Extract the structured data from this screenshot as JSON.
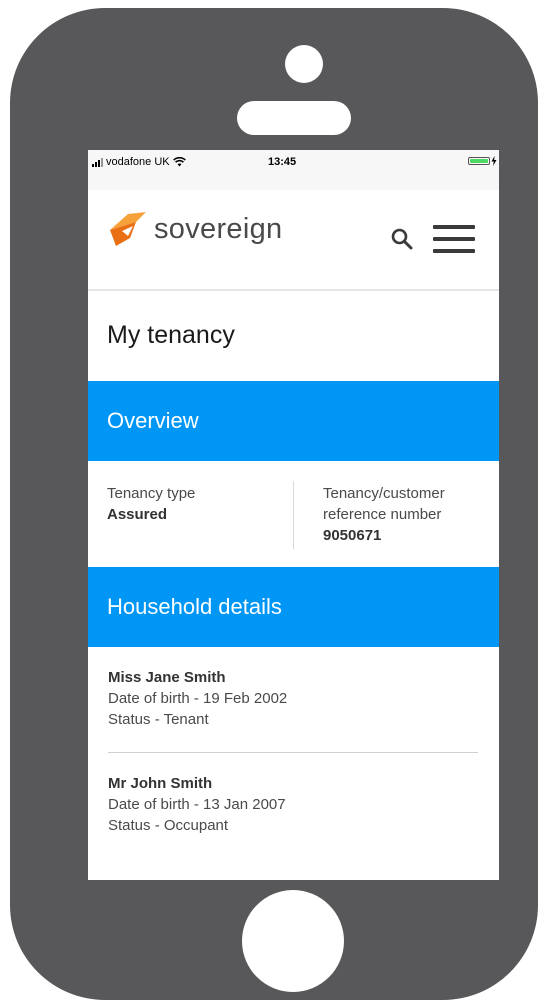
{
  "status_bar": {
    "carrier": "vodafone UK",
    "time": "13:45"
  },
  "header": {
    "logo_text": "sovereign",
    "logo_color": "#f28c1e",
    "icons": [
      "search-icon",
      "hamburger-menu-icon"
    ]
  },
  "page": {
    "title": "My tenancy"
  },
  "overview": {
    "heading": "Overview",
    "tenancy_type_label": "Tenancy type",
    "tenancy_type_value": "Assured",
    "reference_label": "Tenancy/customer reference number",
    "reference_value": "9050671"
  },
  "household": {
    "heading": "Household details",
    "members": [
      {
        "name": "Miss  Jane Smith",
        "dob": "Date of birth - 19 Feb 2002",
        "status": "Status - Tenant"
      },
      {
        "name": "Mr  John Smith",
        "dob": "Date of birth - 13 Jan 2007",
        "status": "Status - Occupant"
      }
    ]
  },
  "colors": {
    "section_band": "#0096f5",
    "phone_body": "#58585a",
    "battery": "#4cd964"
  }
}
